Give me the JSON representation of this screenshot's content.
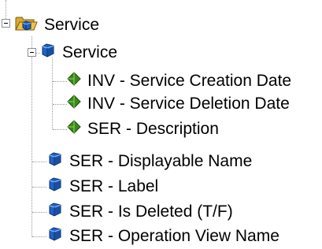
{
  "tree": {
    "root": {
      "label": "Service",
      "icon": "open-folder-with-cube-icon",
      "expanded": true
    },
    "class_node": {
      "label": "Service",
      "icon": "cube-icon",
      "expanded": true
    },
    "class_children": [
      {
        "label": "INV - Service Creation Date",
        "icon": "diamond-icon"
      },
      {
        "label": "INV - Service Deletion Date",
        "icon": "diamond-icon"
      },
      {
        "label": "SER - Description",
        "icon": "diamond-icon"
      }
    ],
    "root_children": [
      {
        "label": "SER - Displayable Name",
        "icon": "cube-icon"
      },
      {
        "label": "SER - Label",
        "icon": "cube-icon"
      },
      {
        "label": "SER - Is Deleted (T/F)",
        "icon": "cube-icon"
      },
      {
        "label": "SER - Operation View Name",
        "icon": "cube-icon"
      }
    ]
  },
  "colors": {
    "cube_blue": "#1f63c6",
    "diamond_green": "#3a8a18",
    "tree_line": "#9a9a9a",
    "folder_yellow": "#f0c24a"
  }
}
